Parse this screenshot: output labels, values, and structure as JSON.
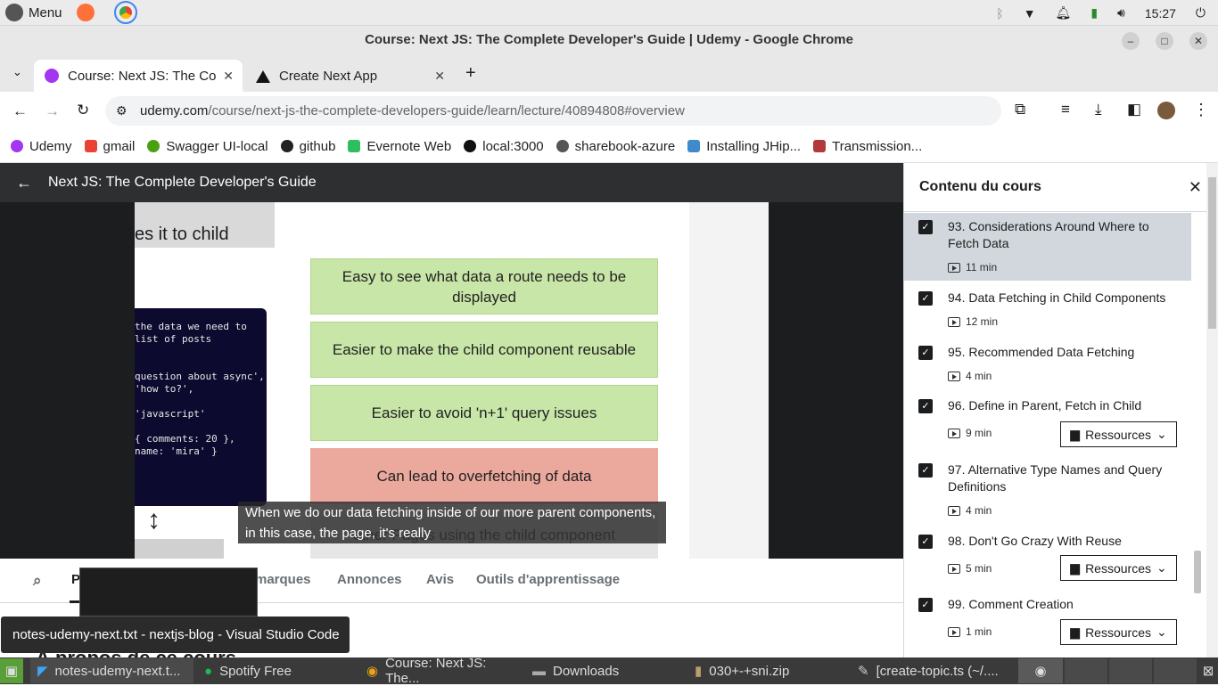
{
  "system": {
    "menu_label": "Menu",
    "clock": "15:27"
  },
  "window": {
    "title": "Course: Next JS: The Complete Developer's Guide | Udemy - Google Chrome"
  },
  "tabs": [
    {
      "label": "Course: Next JS: The Co"
    },
    {
      "label": "Create Next App"
    }
  ],
  "address": {
    "host": "udemy.com",
    "path": "/course/next-js-the-complete-developers-guide/learn/lecture/40894808#overview"
  },
  "bookmarks": [
    {
      "label": "Udemy",
      "color": "#a435f0"
    },
    {
      "label": "gmail",
      "color": "#ea4335"
    },
    {
      "label": "Swagger UI-local",
      "color": "#49a010"
    },
    {
      "label": "github",
      "color": "#222222"
    },
    {
      "label": "Evernote Web",
      "color": "#2dbe60"
    },
    {
      "label": "local:3000",
      "color": "#111111"
    },
    {
      "label": "sharebook-azure",
      "color": "#555555"
    },
    {
      "label": "Installing JHip...",
      "color": "#3e8acc"
    },
    {
      "label": "Transmission...",
      "color": "#b33a3a"
    }
  ],
  "course": {
    "title": "Next JS: The Complete Developer's Guide"
  },
  "slide": {
    "header_text": "es it to child",
    "boxes": [
      "Easy to see what data a route needs to be displayed",
      "Easier to make the child component reusable",
      "Easier to avoid 'n+1' query issues",
      "Can lead to overfetching of data",
      "other Pages using the child component"
    ],
    "code_lines": [
      "the data we need to",
      "list of posts",
      "",
      "",
      "question about async',",
      "'how to?',",
      "",
      "'javascript'",
      "",
      "{ comments: 20 },",
      "name: 'mira' }"
    ]
  },
  "caption": {
    "text": "When we do our data fetching inside of our more parent components, in this case, the page, it's really"
  },
  "course_tabs": [
    "P",
    "marques",
    "Annonces",
    "Avis",
    "Outils d'apprentissage"
  ],
  "about_heading": "À propos de ce cours",
  "sidebar": {
    "title": "Contenu du cours",
    "resources_label": "Ressources",
    "items": [
      {
        "title": "93. Considerations Around Where to Fetch Data",
        "duration": "11 min"
      },
      {
        "title": "94. Data Fetching in Child Components",
        "duration": "12 min"
      },
      {
        "title": "95. Recommended Data Fetching",
        "duration": "4 min"
      },
      {
        "title": "96. Define in Parent, Fetch in Child",
        "duration": "9 min"
      },
      {
        "title": "97. Alternative Type Names and Query Definitions",
        "duration": "4 min"
      },
      {
        "title": "98. Don't Go Crazy With Reuse",
        "duration": "5 min"
      },
      {
        "title": "99. Comment Creation",
        "duration": "1 min"
      }
    ]
  },
  "tooltip": {
    "text": "notes-udemy-next.txt - nextjs-blog - Visual Studio Code"
  },
  "taskbar": [
    {
      "label": "notes-udemy-next.t..."
    },
    {
      "label": "Spotify Free"
    },
    {
      "label": "Course: Next JS: The..."
    },
    {
      "label": "Downloads"
    },
    {
      "label": "030+-+sni.zip"
    },
    {
      "label": "[create-topic.ts (~/...."
    }
  ]
}
